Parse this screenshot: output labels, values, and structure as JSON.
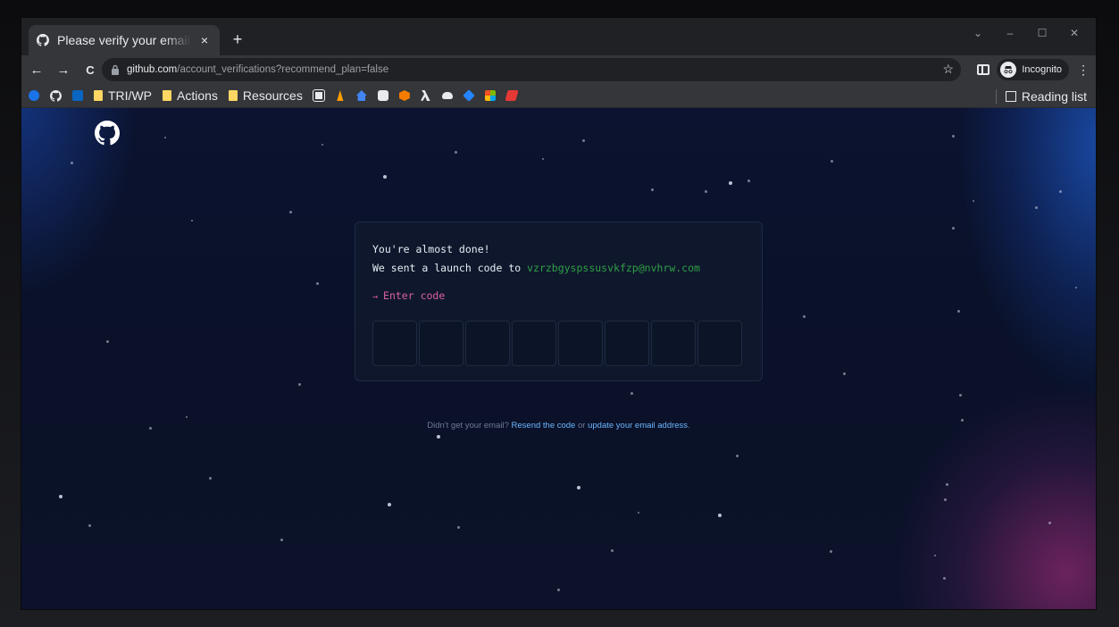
{
  "browser": {
    "tab": {
      "title": "Please verify your email",
      "close": "×"
    },
    "new_tab": "+",
    "window_controls": {
      "collapse": "⌄",
      "minimize": "–",
      "maximize": "☐",
      "close": "✕"
    },
    "nav": {
      "back": "←",
      "forward": "→",
      "reload": "C"
    },
    "url": {
      "host": "github.com",
      "path": "/account_verifications?recommend_plan=false"
    },
    "bookmark_star": "☆",
    "incognito_label": "Incognito",
    "menu": "⋮",
    "bookmarks": [
      {
        "label": "TRI/WP",
        "type": "folder"
      },
      {
        "label": "Actions",
        "type": "folder"
      },
      {
        "label": "Resources",
        "type": "folder"
      }
    ],
    "reading_list": "Reading list"
  },
  "verification": {
    "line1": "You're almost done!",
    "line2_prefix": "We sent a launch code to ",
    "email": "vzrzbgyspssusvkfzp@nvhrw.com",
    "enter_code": "Enter code",
    "arrow": "→",
    "code_boxes": 8
  },
  "footer": {
    "prefix": "Didn't get your email? ",
    "resend_link": "Resend the code",
    "middle": " or ",
    "update_link": "update your email address",
    "suffix": "."
  },
  "colors": {
    "accent_green": "#2ea043",
    "accent_pink": "#db61a2",
    "link_blue": "#6cb6ff",
    "page_bg": "#0b1330"
  }
}
